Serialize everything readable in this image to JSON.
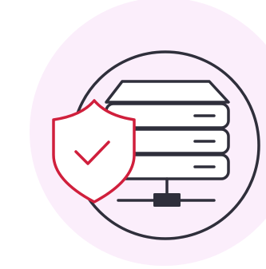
{
  "illustration": {
    "subject": "server-security",
    "colors": {
      "background_blob": "#fbeefb",
      "outline": "#2f2f3b",
      "shield": "#d01f3c",
      "server_fill": "#ffffff",
      "page_background": "#ffffff"
    },
    "icons": [
      "server-rack-icon",
      "shield-check-icon",
      "network-connector-icon"
    ]
  }
}
